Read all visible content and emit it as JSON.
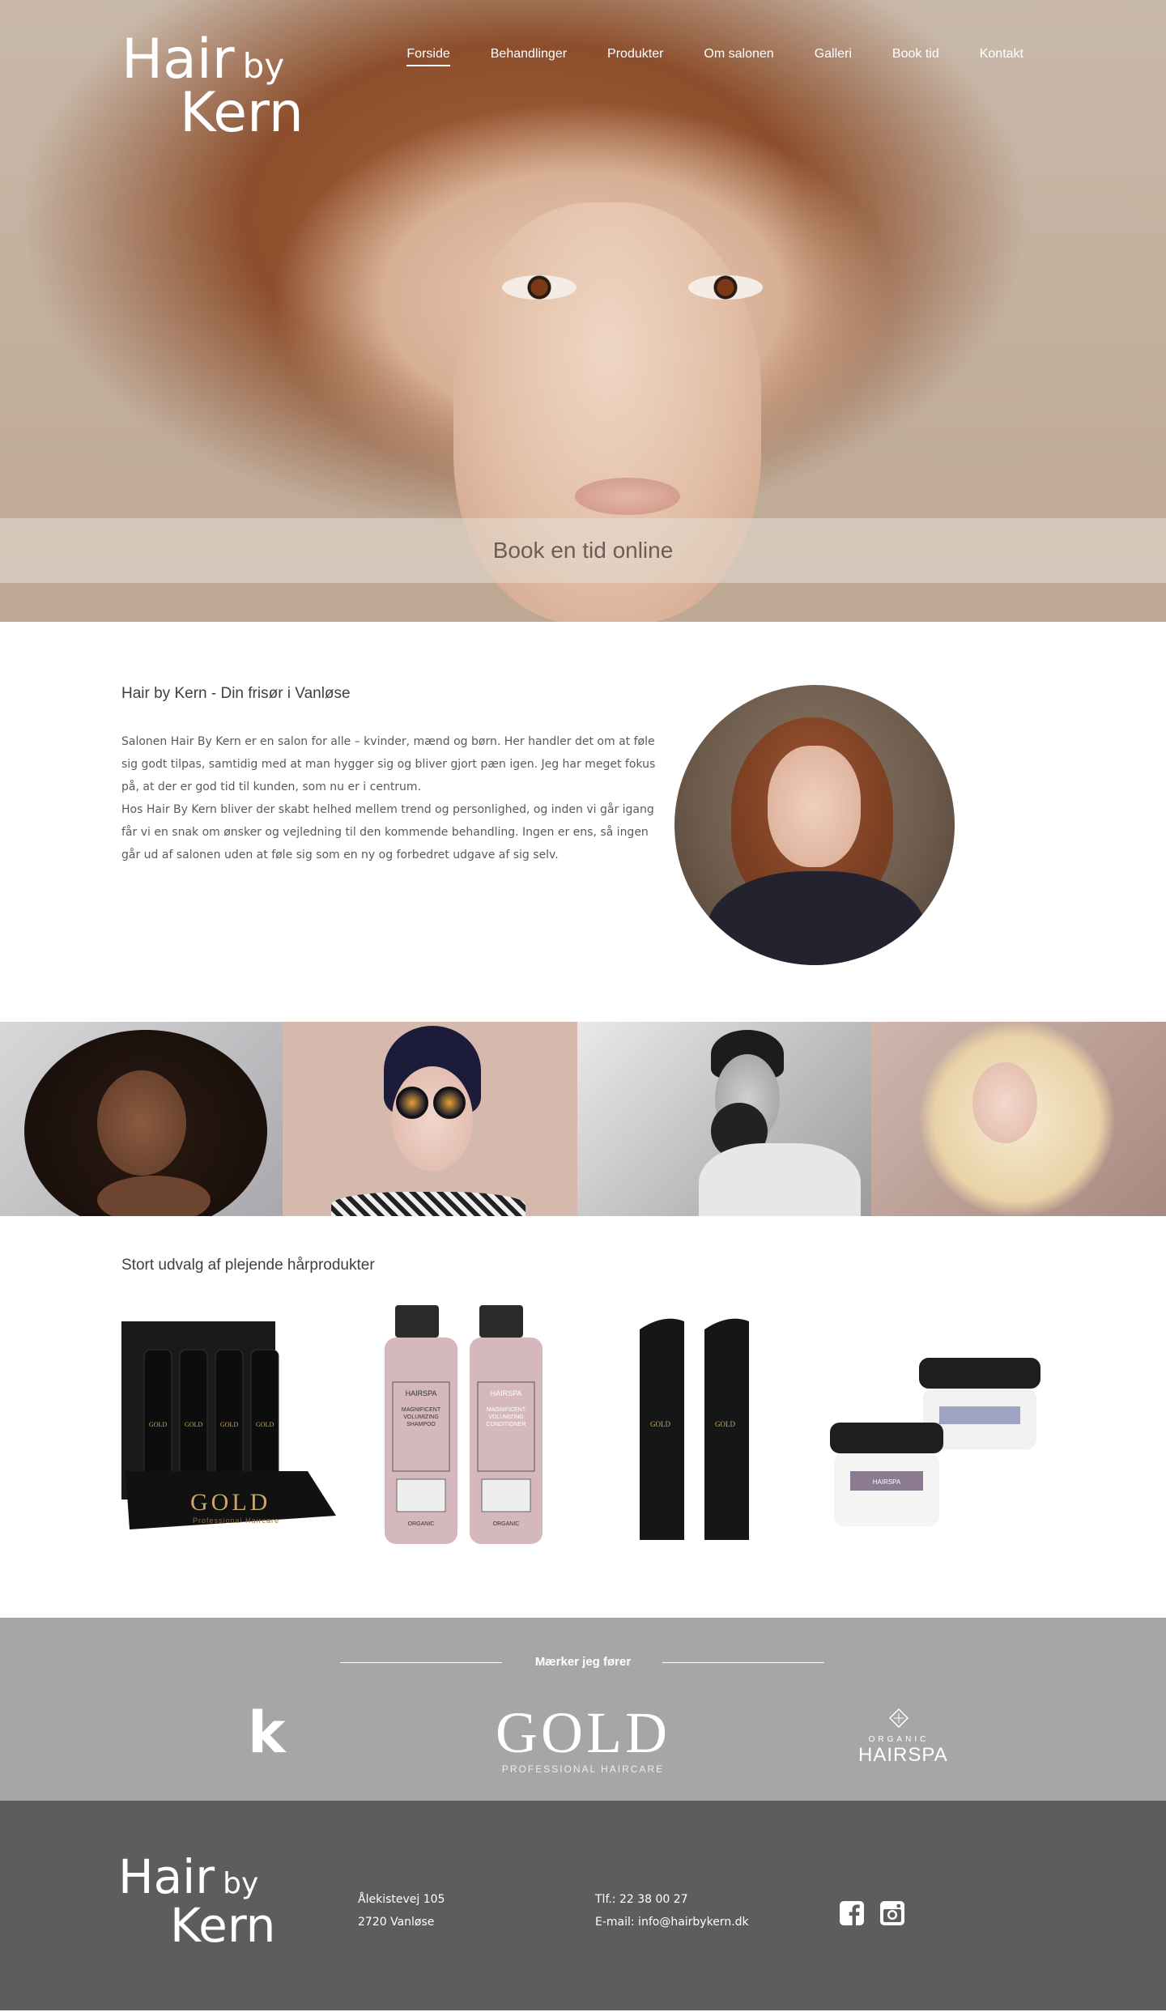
{
  "brand": {
    "logo_line1": "Hair",
    "logo_by": "by",
    "logo_line2": "Kern"
  },
  "nav": {
    "items": [
      {
        "label": "Forside",
        "active": true
      },
      {
        "label": "Behandlinger"
      },
      {
        "label": "Produkter"
      },
      {
        "label": "Om salonen"
      },
      {
        "label": "Galleri"
      },
      {
        "label": "Book tid"
      },
      {
        "label": "Kontakt"
      }
    ]
  },
  "hero": {
    "book_label": "Book en tid online"
  },
  "intro": {
    "heading": "Hair by Kern - Din frisør i Vanløse",
    "paragraph1": "Salonen Hair By Kern er en salon for alle – kvinder, mænd og børn. Her handler det om at føle sig godt tilpas, samtidig med at man hygger sig og bliver gjort pæn igen. Jeg har meget fokus på, at der er god tid til kunden, som nu er i centrum.",
    "paragraph2": "Hos Hair By Kern bliver der skabt helhed mellem trend og personlighed, og inden vi går igang får vi en snak om ønsker og vejledning til den kommende behandling. Ingen er ens, så ingen går ud af salonen uden at føle sig som en ny og forbedret udgave af sig selv."
  },
  "products": {
    "heading": "Stort udvalg af plejende hårprodukter",
    "gold_display_text": "GOLD",
    "gold_display_sub": "Professional Haircare",
    "shampoo_label": "MAGNIFICENT VOLUMIZING SHAMPOO",
    "conditioner_label": "MAGNIFICENT VOLUMIZING CONDITIONER",
    "organic_tag": "ORGANIC",
    "hairspa": "HAIRSPA"
  },
  "brands": {
    "title": "Mærker jeg fører",
    "k_letter": "k",
    "gold": "GOLD",
    "gold_sub": "PROFESSIONAL HAIRCARE",
    "organic": "ORGANIC",
    "hairspa": "HAIRSPA"
  },
  "footer": {
    "address_line1": "Ålekistevej 105",
    "address_line2": "2720 Vanløse",
    "phone": "Tlf.: 22 38 00 27",
    "email": "E-mail: info@hairbykern.dk",
    "social": [
      "facebook-icon",
      "instagram-icon"
    ]
  },
  "colors": {
    "brand_band": "#a5a7a6",
    "footer": "#5d5d5d",
    "gold": "#c7a86b"
  }
}
